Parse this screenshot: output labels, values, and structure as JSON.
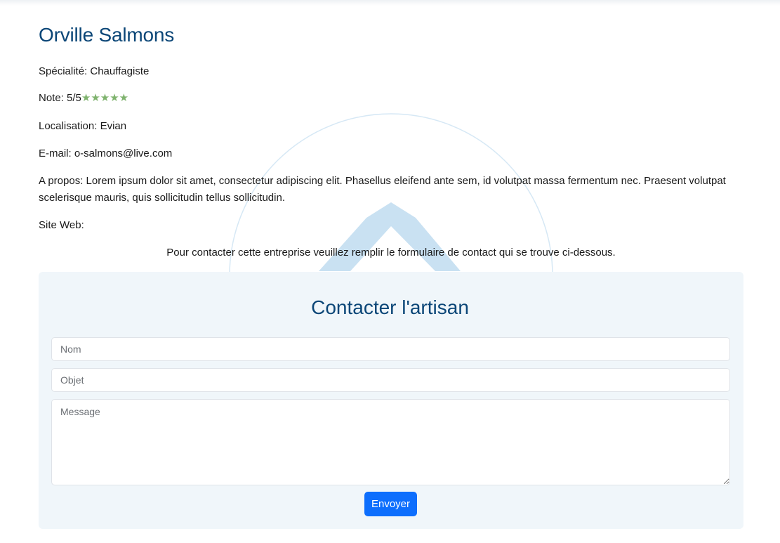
{
  "profile": {
    "name": "Orville Salmons",
    "specialty_label": "Spécialité: ",
    "specialty": "Chauffagiste",
    "rating_label": "Note: ",
    "rating_text": "5/5",
    "rating_value": 5,
    "rating_max": 5,
    "stars": "★★★★★",
    "location_label": "Localisation: ",
    "location": "Evian",
    "email_label": "E-mail: ",
    "email": "o-salmons@live.com",
    "about_label": "A propos: ",
    "about": "Lorem ipsum dolor sit amet, consectetur adipiscing elit. Phasellus eleifend ante sem, id volutpat massa fermentum nec. Praesent volutpat scelerisque mauris, quis sollicitudin tellus sollicitudin.",
    "website_label": "Site Web:",
    "website": ""
  },
  "contact_note": "Pour contacter cette entreprise veuillez remplir le formulaire de contact qui se trouve ci-dessous.",
  "form": {
    "title": "Contacter l'artisan",
    "name_placeholder": "Nom",
    "subject_placeholder": "Objet",
    "message_placeholder": "Message",
    "submit_label": "Envoyer"
  },
  "colors": {
    "title": "#0b4677",
    "stars": "#7fb36e",
    "button": "#0d6efd",
    "card_bg": "#f0f6fa",
    "watermark": "#c9e1f2"
  }
}
